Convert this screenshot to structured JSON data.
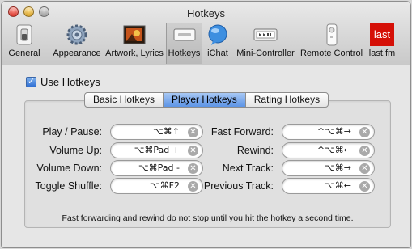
{
  "window": {
    "title": "Hotkeys"
  },
  "toolbar": {
    "items": [
      {
        "label": "General",
        "icon": "switch-icon"
      },
      {
        "label": "Appearance",
        "icon": "gear-icon"
      },
      {
        "label": "Artwork, Lyrics",
        "icon": "artwork-icon"
      },
      {
        "label": "Hotkeys",
        "icon": "keyboard-icon",
        "selected": true
      },
      {
        "label": "iChat",
        "icon": "ichat-icon"
      },
      {
        "label": "Mini-Controller",
        "icon": "mini-controller-icon"
      },
      {
        "label": "Remote Control",
        "icon": "remote-icon"
      },
      {
        "label": "last.fm",
        "icon": "lastfm-icon",
        "icon_text": "last"
      }
    ]
  },
  "use_hotkeys": {
    "label": "Use Hotkeys",
    "checked": true
  },
  "tabs": [
    {
      "label": "Basic Hotkeys",
      "active": false
    },
    {
      "label": "Player Hotkeys",
      "active": true
    },
    {
      "label": "Rating Hotkeys",
      "active": false
    }
  ],
  "hotkeys": {
    "play_pause": {
      "label": "Play / Pause:",
      "value": "⌥⌘↑"
    },
    "volume_up": {
      "label": "Volume Up:",
      "value": "⌥⌘Pad +"
    },
    "volume_down": {
      "label": "Volume Down:",
      "value": "⌥⌘Pad -"
    },
    "toggle_shuffle": {
      "label": "Toggle Shuffle:",
      "value": "⌥⌘F2"
    },
    "fast_forward": {
      "label": "Fast Forward:",
      "value": "^⌥⌘→"
    },
    "rewind": {
      "label": "Rewind:",
      "value": "^⌥⌘←"
    },
    "next_track": {
      "label": "Next Track:",
      "value": "⌥⌘→"
    },
    "previous_track": {
      "label": "Previous Track:",
      "value": "⌥⌘←"
    }
  },
  "note": "Fast forwarding and rewind do not stop until you hit the hotkey a second time.",
  "colors": {
    "accent": "#5d94e6",
    "lastfm": "#d51007"
  }
}
